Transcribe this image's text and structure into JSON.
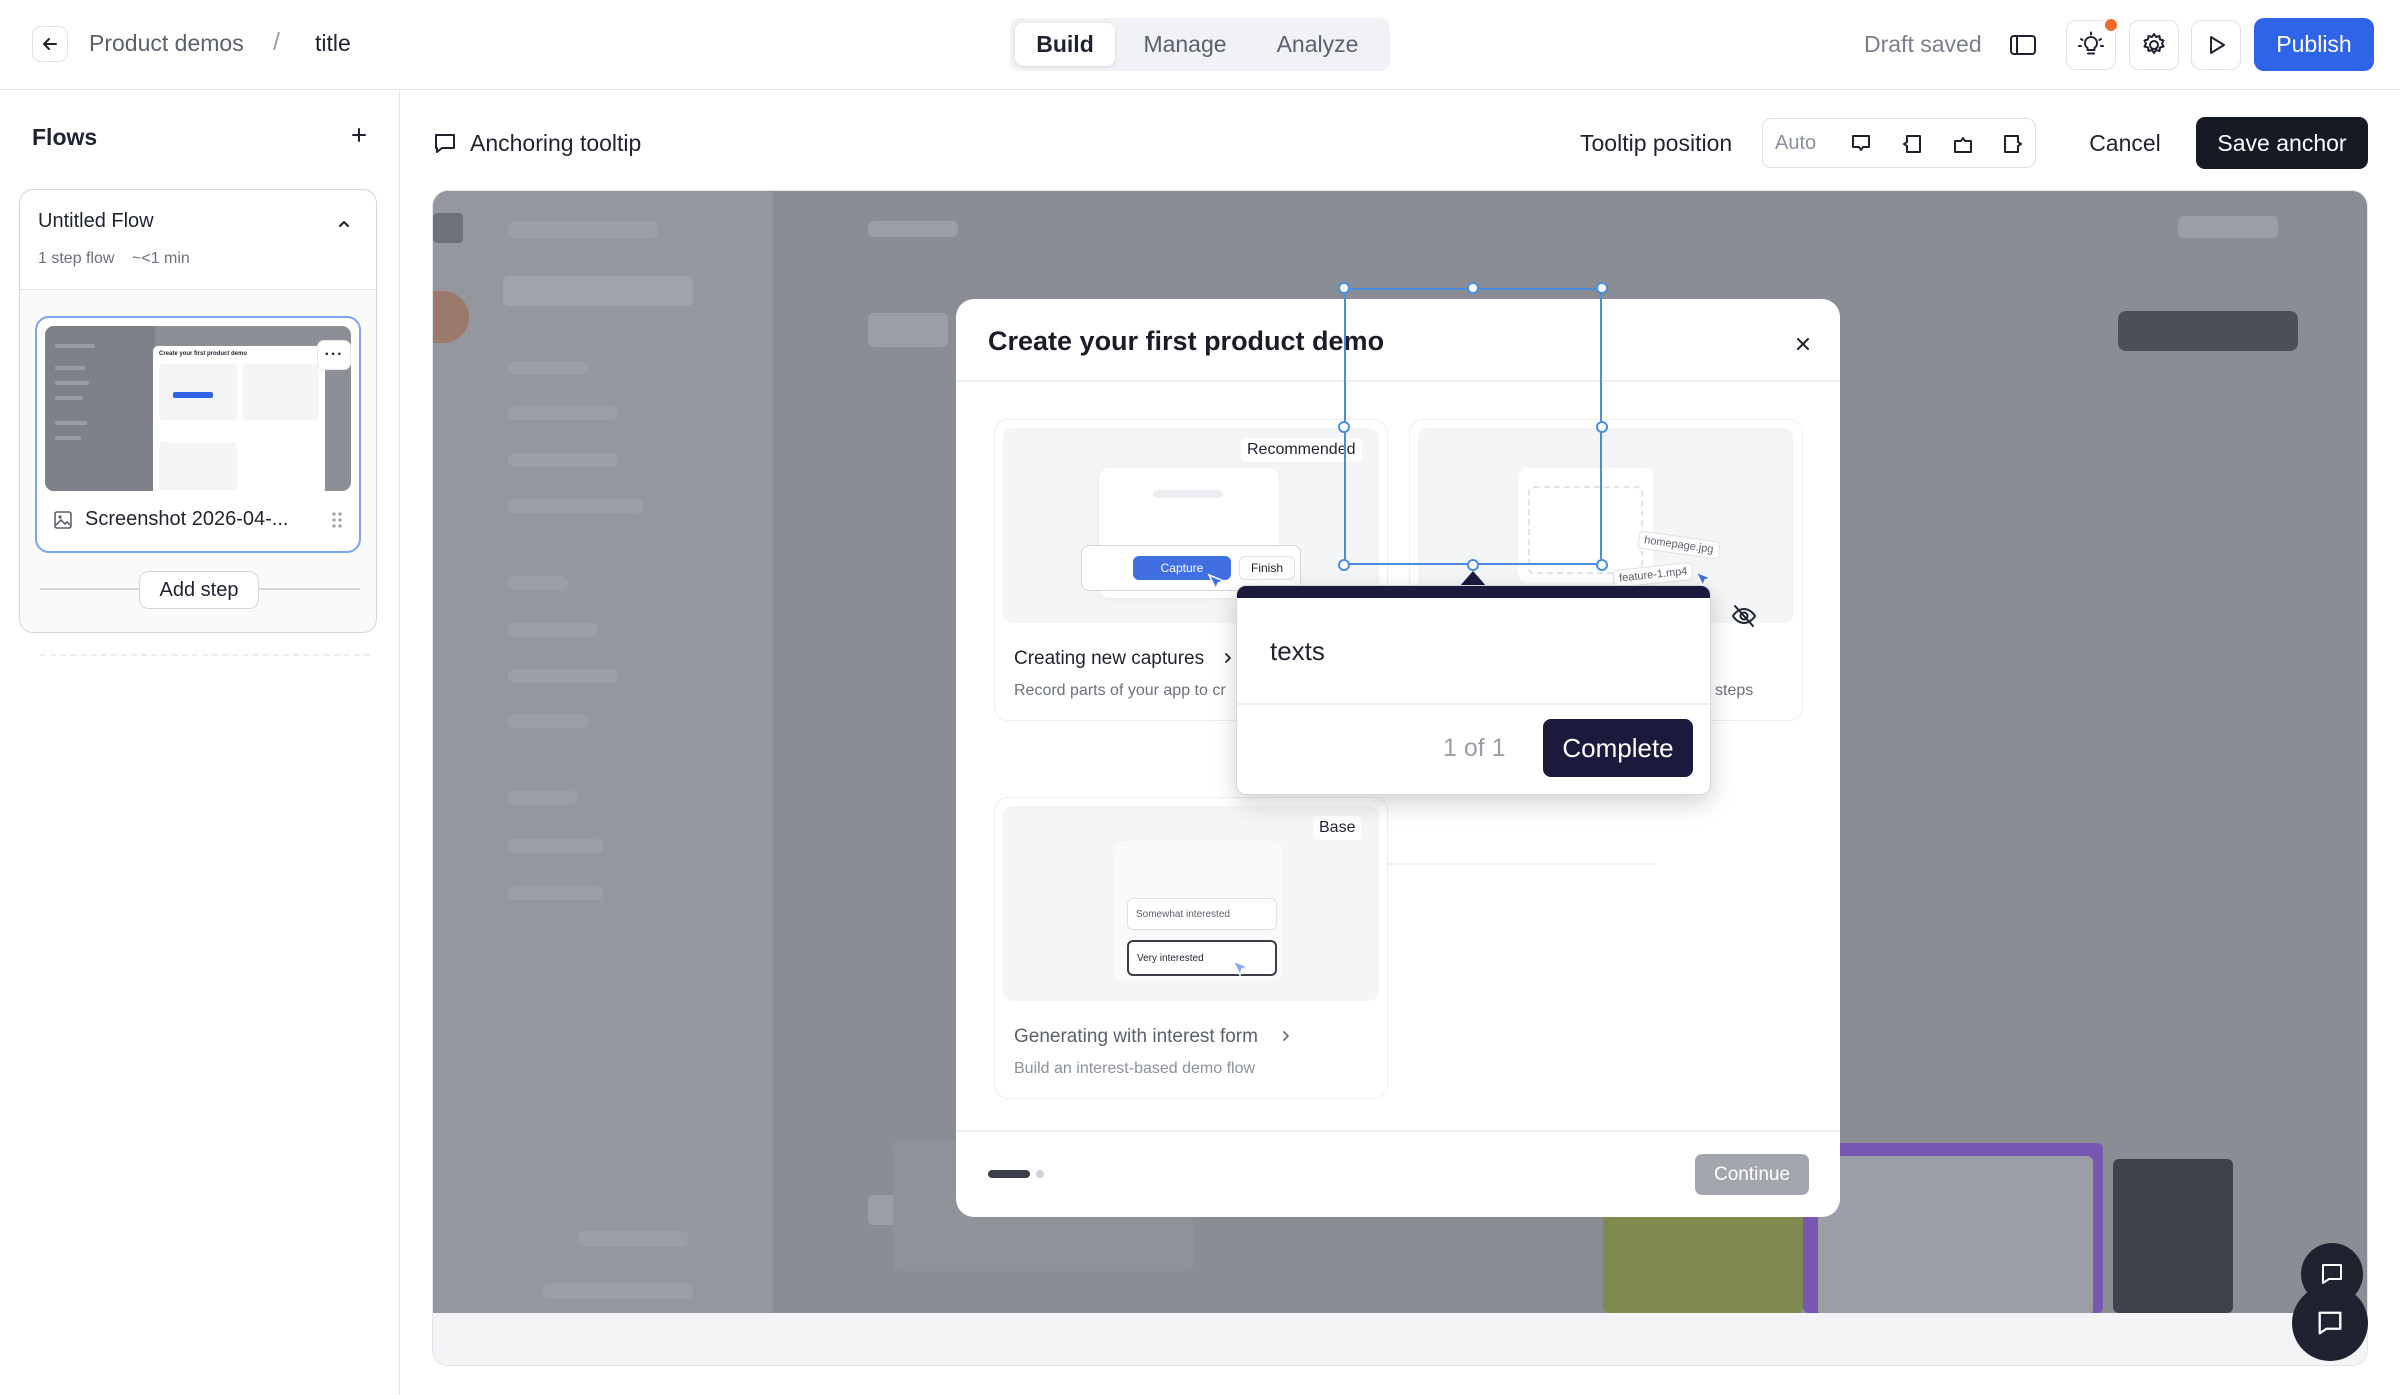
{
  "topbar": {
    "breadcrumb_parent": "Product demos",
    "breadcrumb_sep": "/",
    "breadcrumb_title": "title",
    "tabs": [
      {
        "label": "Build",
        "active": true
      },
      {
        "label": "Manage",
        "active": false
      },
      {
        "label": "Analyze",
        "active": false
      }
    ],
    "draft_status": "Draft saved",
    "publish_label": "Publish",
    "accent_color": "#2f64e8",
    "notification_color": "#f26b2c"
  },
  "sidebar": {
    "title": "Flows",
    "flow": {
      "name": "Untitled Flow",
      "step_count": "1 step flow",
      "duration": "~<1 min",
      "step": {
        "label": "Screenshot 2026-04-...",
        "thumb_title": "Create your first product demo"
      }
    },
    "add_step_label": "Add step"
  },
  "editor": {
    "mode_title": "Anchoring tooltip",
    "tooltip_position_label": "Tooltip position",
    "position_options": [
      "Auto"
    ],
    "cancel_label": "Cancel",
    "save_label": "Save anchor"
  },
  "modal": {
    "title": "Create your first product demo",
    "options": [
      {
        "title": "Creating new captures",
        "description": "Record parts of your app to cr",
        "badge": "Recommended",
        "chip_capture": "Capture",
        "chip_finish": "Finish"
      },
      {
        "title": "",
        "description": "steps",
        "file_a": "homepage.jpg",
        "file_b": "feature-1.mp4"
      },
      {
        "title": "Generating with interest form",
        "description": "Build an interest-based demo flow",
        "badge": "Base",
        "field_a": "Somewhat interested",
        "field_b": "Very interested"
      }
    ],
    "continue_label": "Continue"
  },
  "tooltip": {
    "text": "texts",
    "counter": "1 of 1",
    "complete_label": "Complete",
    "theme_color": "#1b1a3d"
  }
}
